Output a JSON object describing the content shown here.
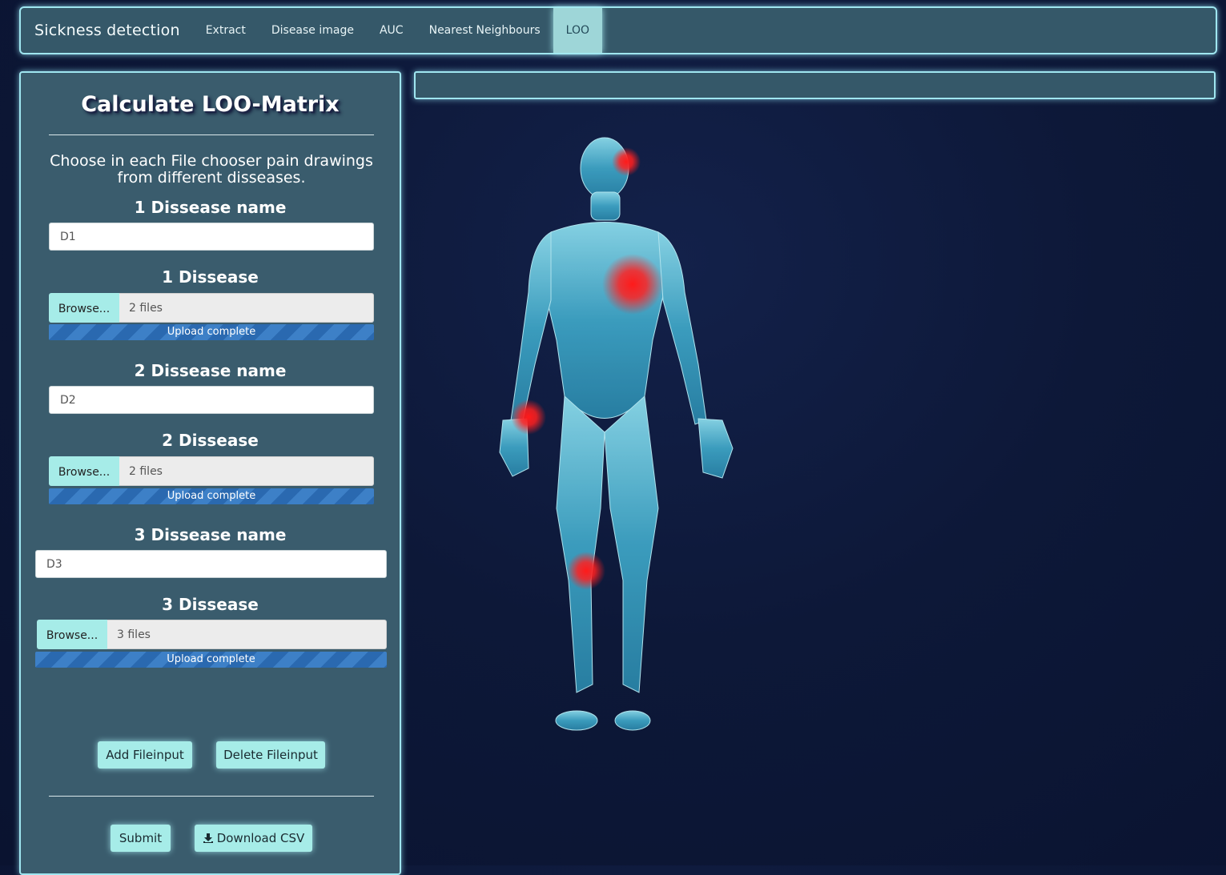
{
  "navbar": {
    "brand": "Sickness detection",
    "items": [
      "Extract",
      "Disease image",
      "AUC",
      "Nearest Neighbours",
      "LOO"
    ],
    "active": "LOO"
  },
  "sidebar": {
    "title": "Calculate LOO-Matrix",
    "instructions": "Choose in each File chooser pain drawings from different disseases.",
    "groups": [
      {
        "name_label": "1 Dissease name",
        "name_value": "D1",
        "file_label": "1 Dissease",
        "browse_label": "Browse...",
        "files": "2 files",
        "progress": "Upload complete",
        "progress_fraction": 1.0
      },
      {
        "name_label": "2 Dissease name",
        "name_value": "D2",
        "file_label": "2 Dissease",
        "browse_label": "Browse...",
        "files": "2 files",
        "progress": "Upload complete",
        "progress_fraction": 1.0
      },
      {
        "name_label": "3 Dissease name",
        "name_value": "D3",
        "file_label": "3 Dissease",
        "browse_label": "Browse...",
        "files": "3 files",
        "progress": "Upload complete",
        "progress_fraction": 1.0
      }
    ],
    "add_button": "Add Fileinput",
    "delete_button": "Delete Fileinput",
    "submit_button": "Submit",
    "download_button": "Download CSV"
  },
  "colors": {
    "accent": "#a6ece8",
    "panel": "#3a5c6d",
    "border_glow": "#9fe6f0",
    "progress": "#3d80c7",
    "pain_marker": "#ff1a1a"
  },
  "icons": {
    "download": "download-icon"
  }
}
